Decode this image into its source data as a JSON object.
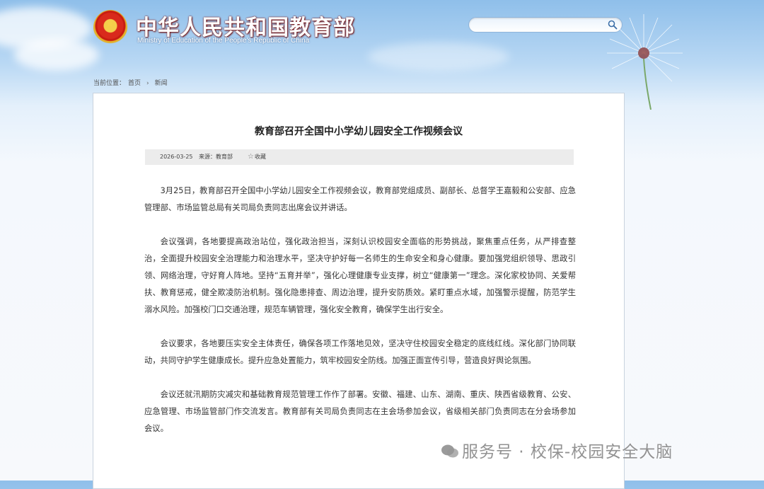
{
  "header": {
    "site_title": "中华人民共和国教育部",
    "site_subtitle": "Ministry of Education of the People's Republic of China"
  },
  "search": {
    "placeholder": "",
    "value": ""
  },
  "breadcrumb": {
    "prefix": "当前位置：",
    "home": "首页",
    "separator": "›",
    "current": "新闻"
  },
  "article": {
    "title": "教育部召开全国中小学幼儿园安全工作视频会议",
    "date": "2026-03-25",
    "source": "来源：教育部",
    "favorite_label": "收藏",
    "paragraphs": [
      "3月25日，教育部召开全国中小学幼儿园安全工作视频会议，教育部党组成员、副部长、总督学王嘉毅和公安部、应急管理部、市场监管总局有关司局负责同志出席会议并讲话。",
      "会议强调，各地要提高政治站位，强化政治担当，深刻认识校园安全面临的形势挑战，聚焦重点任务，从严排查整治，全面提升校园安全治理能力和治理水平，坚决守护好每一名师生的生命安全和身心健康。要加强党组织领导、思政引领、网络治理，守好育人阵地。坚持“五育并举”，强化心理健康专业支撑，树立“健康第一”理念。深化家校协同、关爱帮扶、教育惩戒，健全欺凌防治机制。强化隐患排查、周边治理，提升安防质效。紧盯重点水域，加强警示提醒，防范学生溺水风险。加强校门口交通治理，规范车辆管理，强化安全教育，确保学生出行安全。",
      "会议要求，各地要压实安全主体责任，确保各项工作落地见效，坚决守住校园安全稳定的底线红线。深化部门协同联动，共同守护学生健康成长。提升应急处置能力，筑牢校园安全防线。加强正面宣传引导，营造良好舆论氛围。",
      "会议还就汛期防灾减灾和基础教育规范管理工作作了部署。安徽、福建、山东、湖南、重庆、陕西省级教育、公安、应急管理、市场监管部门作交流发言。教育部有关司局负责同志在主会场参加会议，省级相关部门负责同志在分会场参加会议。"
    ]
  },
  "watermark": "服务号 · 校保-校园安全大脑",
  "colors": {
    "title_red": "#c81d12",
    "search_border": "#8fb4da",
    "meta_bg": "#ececec"
  },
  "icons": [
    "national-emblem-icon",
    "search-icon",
    "star-icon",
    "wechat-icon"
  ]
}
